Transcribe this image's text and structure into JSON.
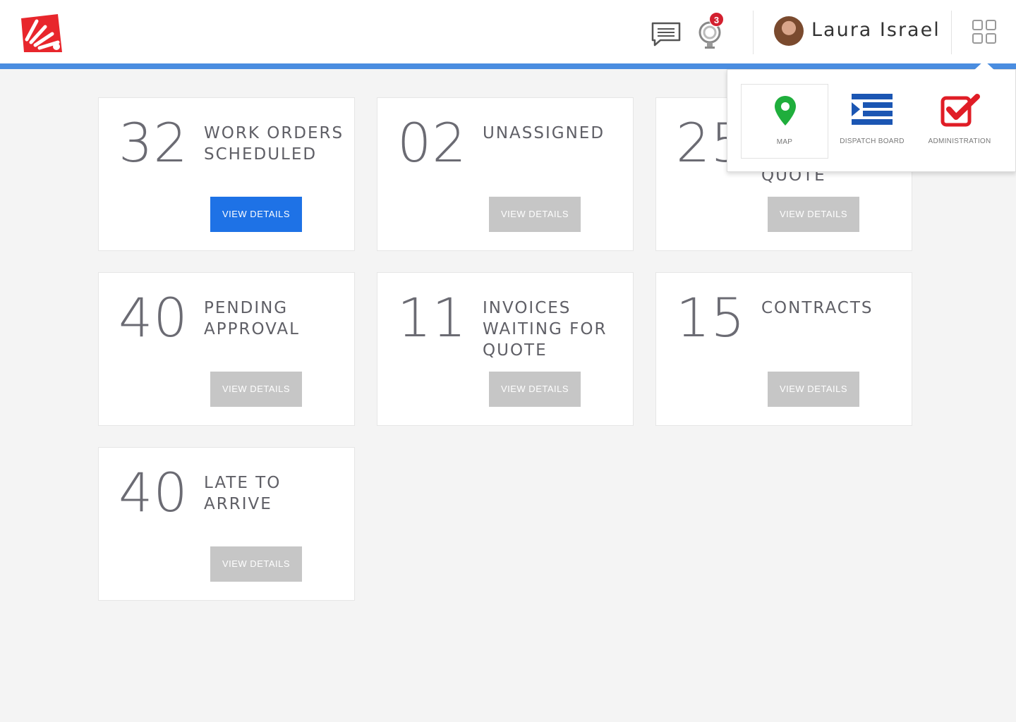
{
  "header": {
    "notification_count": "3",
    "user_name": "Laura Israel"
  },
  "cards": [
    {
      "number": "32",
      "label": "WORK ORDERS SCHEDULED",
      "button": "VIEW DETAILS",
      "active": true
    },
    {
      "number": "02",
      "label": "UNASSIGNED",
      "button": "VIEW DETAILS",
      "active": false
    },
    {
      "number": "25",
      "label": "QUOTE",
      "button": "VIEW DETAILS",
      "active": false
    },
    {
      "number": "40",
      "label": "PENDING APPROVAL",
      "button": "VIEW DETAILS",
      "active": false
    },
    {
      "number": "11",
      "label": "INVOICES WAITING FOR QUOTE",
      "button": "VIEW DETAILS",
      "active": false
    },
    {
      "number": "15",
      "label": "CONTRACTS",
      "button": "VIEW DETAILS",
      "active": false
    },
    {
      "number": "40",
      "label": "LATE TO ARRIVE",
      "button": "VIEW DETAILS",
      "active": false
    }
  ],
  "apps_menu": [
    {
      "label": "MAP",
      "icon": "map-pin-icon",
      "color": "#1fae3c"
    },
    {
      "label": "DISPATCH BOARD",
      "icon": "dispatch-board-icon",
      "color": "#1b56b3"
    },
    {
      "label": "ADMINISTRATION",
      "icon": "checkbox-icon",
      "color": "#e01d26"
    }
  ],
  "colors": {
    "accent_bar": "#4a8de0",
    "primary_button": "#1e72e6",
    "secondary_button": "#c6c6c6",
    "brand_red": "#e8262c"
  }
}
